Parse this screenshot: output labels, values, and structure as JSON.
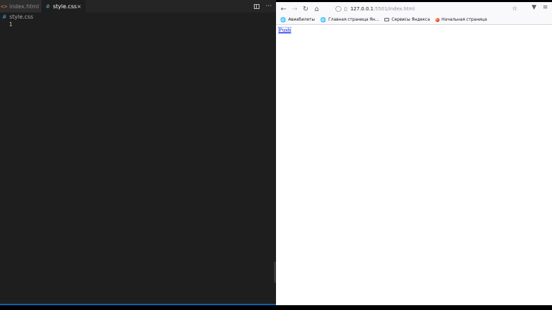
{
  "editor": {
    "tabs": [
      {
        "label": "index.html",
        "active": false,
        "icon": "html-file-icon"
      },
      {
        "label": "style.css",
        "active": true,
        "icon": "css-file-icon",
        "close": "×"
      }
    ],
    "actions": {
      "more": "⋯"
    },
    "breadcrumb": {
      "icon_glyph": "#",
      "file": "style.css"
    },
    "lines": [
      "1"
    ],
    "colors": {
      "background": "#1e1e1e",
      "tab_bar": "#252526",
      "css_icon": "#519aba",
      "html_icon": "#e06c4a",
      "accent": "#0a64b4"
    }
  },
  "browser": {
    "url": {
      "host": "127.0.0.1",
      "rest": ":5501/index.html"
    },
    "bookmarks": [
      {
        "label": "Авиабилеты",
        "icon": "globe-icon"
      },
      {
        "label": "Главная страница Ян...",
        "icon": "globe-icon"
      },
      {
        "label": "Сервисы Яндекса",
        "icon": "folder-icon"
      },
      {
        "label": "Начальная страница",
        "icon": "firefox-icon"
      }
    ],
    "page": {
      "link_text": "Push"
    }
  }
}
